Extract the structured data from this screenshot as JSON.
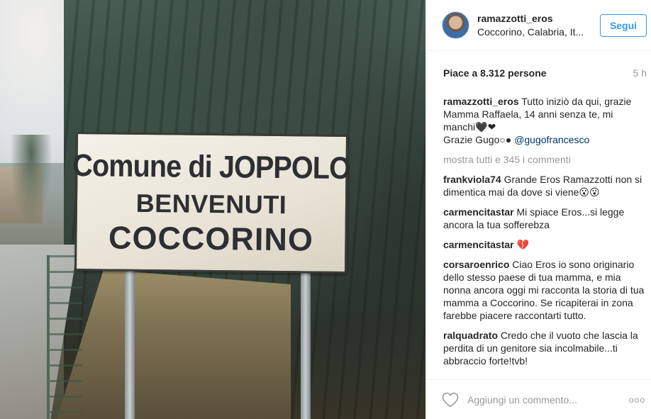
{
  "photo": {
    "sign": {
      "line1": "Comune di JOPPOLO",
      "line2": "BENVENUTI",
      "line3": "COCCORINO"
    }
  },
  "header": {
    "username": "ramazzotti_eros",
    "location": "Coccorino, Calabria, It...",
    "follow_label": "Segui"
  },
  "meta": {
    "likes": "Piace a 8.312 persone",
    "time": "5 h"
  },
  "caption": {
    "user": "ramazzotti_eros",
    "text": "Tutto iniziò da qui, grazie Mamma Raffaela, 14 anni senza te, mi manchi🖤❤",
    "line2_text": "Grazie Gugo○●",
    "mention": "@gugofrancesco"
  },
  "show_all": "mostra tutti e 345 i commenti",
  "comments": [
    {
      "user": "frankviola74",
      "text": "Grande Eros Ramazzotti non si dimentica mai da dove si viene😮😮"
    },
    {
      "user": "carmencitastar",
      "text": "Mi spiace Eros...si legge ancora la tua sofferebza"
    },
    {
      "user": "carmencitastar",
      "text": "💔"
    },
    {
      "user": "corsaroenrico",
      "text": "Ciao Eros io sono originario dello stesso paese di tua mamma, e mia nonna ancora oggi mi racconta la storia di tua mamma a Coccorino. Se ricapiterai in zona farebbe piacere raccontarti tutto."
    },
    {
      "user": "ralquadrato",
      "text": "Credo che il vuoto che lascia la perdita di un genitore sia incolmabile...ti abbraccio forte!tvb!"
    }
  ],
  "footer": {
    "placeholder": "Aggiungi un commento...",
    "more": "ooo",
    "heart_icon": "heart-outline-icon"
  }
}
